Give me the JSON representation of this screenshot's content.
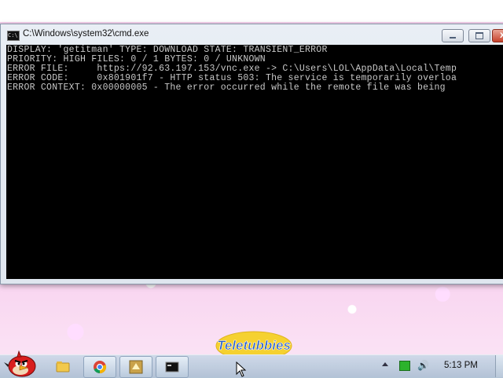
{
  "window": {
    "title": "C:\\Windows\\system32\\cmd.exe",
    "icon_text": "C:\\"
  },
  "console": {
    "lines": [
      "DISPLAY: 'getitman' TYPE: DOWNLOAD STATE: TRANSIENT_ERROR",
      "PRIORITY: HIGH FILES: 0 / 1 BYTES: 0 / UNKNOWN",
      "ERROR FILE:     https://92.63.197.153/vnc.exe -> C:\\Users\\LOL\\AppData\\Local\\Temp",
      "ERROR CODE:     0x801901f7 - HTTP status 503: The service is temporarily overloa",
      "ERROR CONTEXT: 0x00000005 - The error occurred while the remote file was being"
    ],
    "text_color": "#c8c8c8",
    "background": "#000000"
  },
  "taskbar": {
    "start_icon": "angry-bird-start-icon",
    "pinned": [
      {
        "name": "explorer-icon",
        "active": false
      },
      {
        "name": "chrome-icon",
        "active": true
      },
      {
        "name": "app-icon",
        "active": true
      },
      {
        "name": "cmd-icon",
        "active": true
      }
    ],
    "clock": "5:13 PM"
  },
  "wallpaper": {
    "logo_text": "Teletubbies",
    "colors": {
      "pink": "#f3b9e2",
      "logo_yellow": "#f5d130",
      "logo_blue": "#2a5fc8"
    }
  }
}
